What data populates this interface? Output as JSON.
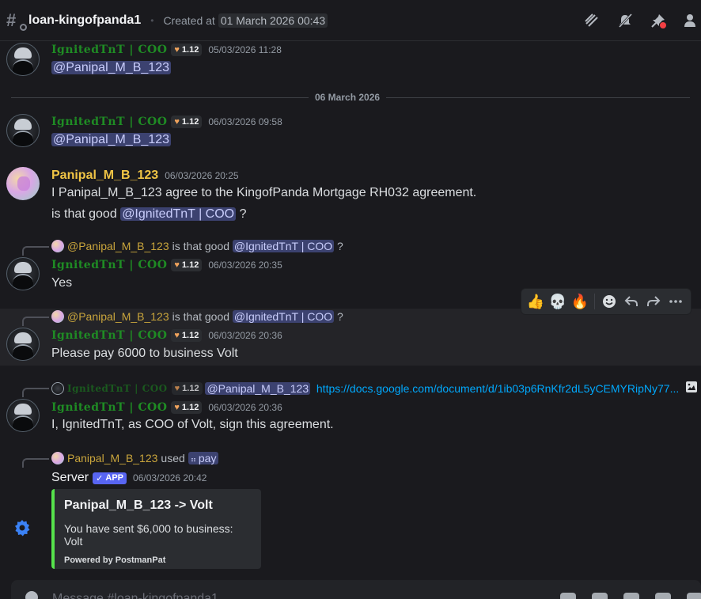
{
  "header": {
    "channel_name": "loan-kingofpanda1",
    "created_label": "Created at",
    "created_date": "01 March 2026 00:43",
    "icons": [
      "threads-icon",
      "mute-icon",
      "pinned-icon",
      "members-icon"
    ]
  },
  "messages": [
    {
      "author": "IgnitedTnT | COO",
      "badge": "1.12",
      "timestamp": "05/03/2026 11:28",
      "content_mention": "@Panipal_M_B_123"
    },
    {
      "author": "IgnitedTnT | COO",
      "badge": "1.12",
      "timestamp": "06/03/2026 09:58",
      "content_mention": "@Panipal_M_B_123"
    },
    {
      "author": "Panipal_M_B_123",
      "timestamp": "06/03/2026 20:25",
      "line1": "I Panipal_M_B_123 agree to the KingofPanda Mortgage RH032 agreement.",
      "line2_text": "is that good",
      "line2_mention": "@IgnitedTnT | COO",
      "line2_suffix": "?"
    },
    {
      "reply_name": "@Panipal_M_B_123",
      "reply_text": "is that good",
      "reply_mention": "@IgnitedTnT | COO",
      "reply_suffix": "?",
      "author": "IgnitedTnT | COO",
      "badge": "1.12",
      "timestamp": "06/03/2026 20:35",
      "content": "Yes"
    },
    {
      "reply_name": "@Panipal_M_B_123",
      "reply_text": "is that good",
      "reply_mention": "@IgnitedTnT | COO",
      "reply_suffix": "?",
      "author": "IgnitedTnT | COO",
      "badge": "1.12",
      "timestamp": "06/03/2026 20:36",
      "content": "Please pay 6000 to business Volt"
    },
    {
      "reply_author": "IgnitedTnT | COO",
      "reply_badge": "1.12",
      "reply_mention": "@Panipal_M_B_123",
      "reply_link": "https://docs.google.com/document/d/1ib03p6RnKfr2dL5yCEMYRipNy77...",
      "author": "IgnitedTnT | COO",
      "badge": "1.12",
      "timestamp": "06/03/2026 20:36",
      "content": "I, IgnitedTnT, as COO of Volt, sign this agreement."
    },
    {
      "reply_name": "Panipal_M_B_123",
      "reply_used": "used",
      "reply_command": "pay",
      "author": "Server",
      "app_tag": "APP",
      "timestamp": "06/03/2026 20:42",
      "embed": {
        "title": "Panipal_M_B_123 -> Volt",
        "description": "You have sent $6,000 to business: Volt",
        "footer": "Powered by PostmanPat",
        "color": "#56e34c"
      }
    }
  ],
  "date_divider": "06 March 2026",
  "hover_toolbar": {
    "reactions": [
      "👍",
      "💀",
      "🔥"
    ],
    "actions": [
      "add-reaction-icon",
      "reply-icon",
      "forward-icon",
      "more-icon"
    ]
  },
  "composer": {
    "placeholder": "Message #loan-kingofpanda1"
  },
  "colors": {
    "background": "#1a1a1e",
    "mention_bg": "#3c4270",
    "gothic_name": "#1f8b24",
    "user_yellow": "#f0c445",
    "app_tag": "#5865f2",
    "link": "#00a8fc"
  }
}
